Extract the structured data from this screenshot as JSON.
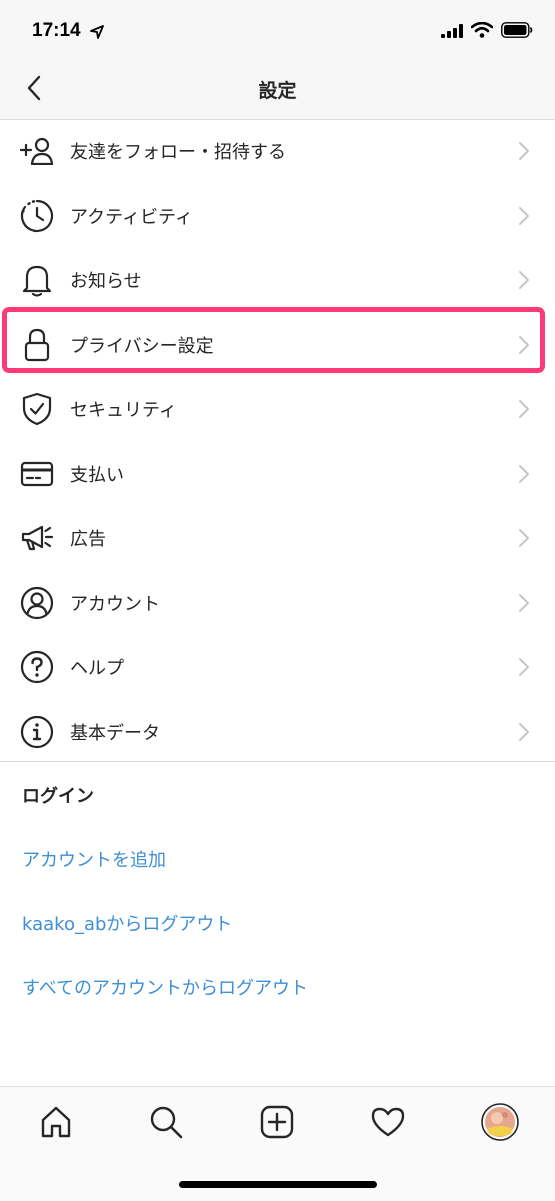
{
  "status_bar": {
    "time": "17:14"
  },
  "header": {
    "title": "設定"
  },
  "menu": [
    {
      "label": "友達をフォロー・招待する",
      "icon": "add-person-icon"
    },
    {
      "label": "アクティビティ",
      "icon": "activity-clock-icon"
    },
    {
      "label": "お知らせ",
      "icon": "bell-icon"
    },
    {
      "label": "プライバシー設定",
      "icon": "lock-icon"
    },
    {
      "label": "セキュリティ",
      "icon": "shield-check-icon"
    },
    {
      "label": "支払い",
      "icon": "credit-card-icon"
    },
    {
      "label": "広告",
      "icon": "megaphone-icon"
    },
    {
      "label": "アカウント",
      "icon": "account-circle-icon"
    },
    {
      "label": "ヘルプ",
      "icon": "help-circle-icon"
    },
    {
      "label": "基本データ",
      "icon": "info-circle-icon"
    }
  ],
  "login": {
    "title": "ログイン",
    "links": [
      "アカウントを追加",
      "kaako_abからログアウト",
      "すべてのアカウントからログアウト"
    ]
  },
  "tab_bar": [
    "home-icon",
    "search-icon",
    "add-post-icon",
    "heart-icon",
    "profile-avatar"
  ],
  "colors": {
    "highlight": "#ff3a78",
    "link": "#3d8fd6"
  }
}
